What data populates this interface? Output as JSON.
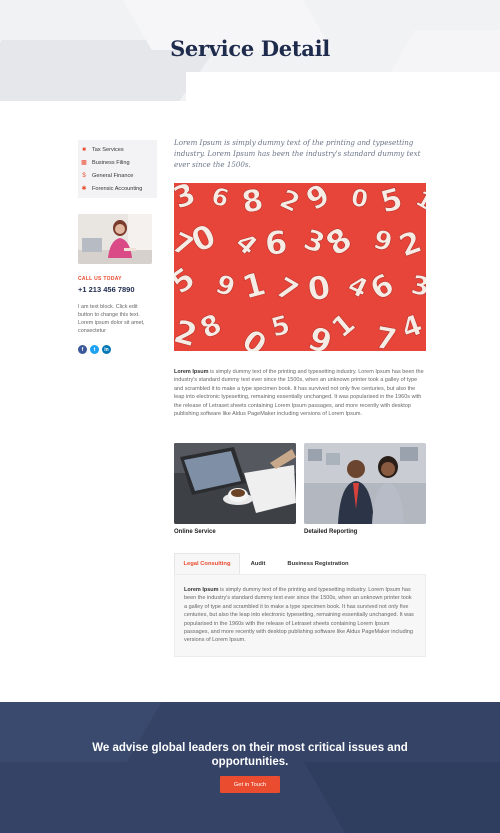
{
  "header": {
    "title": "Service Detail"
  },
  "sidebar": {
    "menu": [
      {
        "label": "Tax Services",
        "icon": "briefcase-icon"
      },
      {
        "label": "Business Filing",
        "icon": "folder-icon"
      },
      {
        "label": "General Finance",
        "icon": "dollar-icon"
      },
      {
        "label": "Forensic Accounting",
        "icon": "gear-icon"
      }
    ],
    "call_label": "CALL US TODAY",
    "phone": "+1 213 456 7890",
    "text": "I am text block. Click edit button to change this text. Lorem ipsum dolor sit amet, consectetur",
    "socials": [
      {
        "name": "facebook-icon",
        "glyph": "f"
      },
      {
        "name": "twitter-icon",
        "glyph": "t"
      },
      {
        "name": "linkedin-icon",
        "glyph": "in"
      }
    ]
  },
  "main": {
    "lead": "Lorem Ipsum is simply dummy text of the printing and typesetting industry. Lorem Ipsum has been the industry's standard dummy text ever since the 1500s.",
    "body_bold": "Lorem Ipsum",
    "body": " is simply dummy text of the printing and typesetting industry. Lorem Ipsum has been the industry's standard dummy text ever since the 1500s, when an unknown printer took a galley of type and scrambled it to make a type specimen book. It has survived not only five centuries, but also the leap into electronic typesetting, remaining essentially unchanged. It was popularised in the 1960s with the release of Letraset sheets containing Lorem Ipsum passages, and more recently with desktop publishing software like Aldus PageMaker including versions of Lorem Ipsum.",
    "cards": [
      {
        "caption": "Online Service"
      },
      {
        "caption": "Detailed Reporting"
      }
    ],
    "tabs": [
      {
        "label": "Legal Consulting",
        "active": true
      },
      {
        "label": "Audit",
        "active": false
      },
      {
        "label": "Business Registration",
        "active": false
      }
    ],
    "tab_content_bold": "Lorem Ipsum",
    "tab_content": " is simply dummy text of the printing and typesetting industry. Lorem Ipsum has been the industry's standard dummy text ever since the 1500s, when an unknown printer took a galley of type and scrambled it to make a type specimen book. It has survived not only five centuries, but also the leap into electronic typesetting, remaining essentially unchanged. It was popularised in the 1960s with the release of Letraset sheets containing Lorem Ipsum passages, and more recently with desktop publishing software like Aldus PageMaker including versions of Lorem Ipsum."
  },
  "cta": {
    "title": "We advise global leaders on their most critical issues and opportunities.",
    "button": "Get in Touch"
  },
  "colors": {
    "accent": "#ea4c2f",
    "navy": "#1e2b4d",
    "footer": "#344366"
  }
}
